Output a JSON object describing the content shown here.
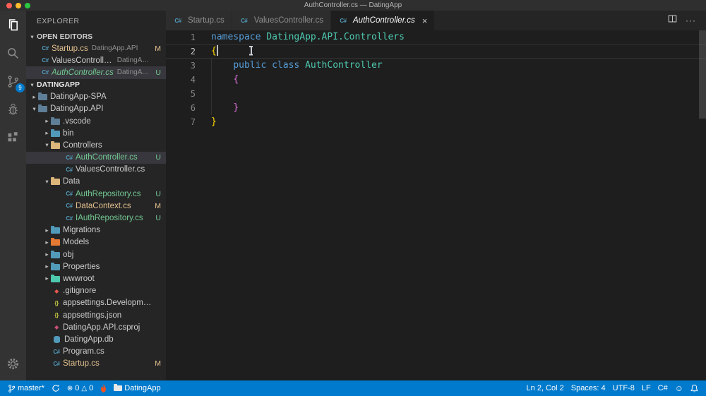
{
  "title_bar": {
    "title": "AuthController.cs — DatingApp"
  },
  "activity_bar": {
    "scm_badge": "9"
  },
  "icons": {
    "twisty_expanded": "▾",
    "twisty_collapsed": "▸",
    "close": "×",
    "error": "⊗",
    "warning": "△",
    "smiley": "☺",
    "ellipsis": "···",
    "cs_glyph": "C#",
    "json_glyph": "{}",
    "diamond_glyph": "◆"
  },
  "sidebar": {
    "title": "EXPLORER",
    "open_editors_label": "OPEN EDITORS",
    "open_editors": [
      {
        "file": "Startup.cs",
        "detail": "DatingApp.API",
        "badge": "M",
        "status": "modified",
        "active": false
      },
      {
        "file": "ValuesController.cs",
        "detail": "DatingApp...",
        "badge": "",
        "status": "none",
        "active": false
      },
      {
        "file": "AuthController.cs",
        "detail": "DatingA...",
        "badge": "U",
        "status": "untracked",
        "active": true
      }
    ],
    "project_label": "DATINGAPP",
    "tree": [
      {
        "label": "DatingApp-SPA",
        "kind": "folder",
        "depth": 0,
        "expanded": false,
        "icon_color": "#5f7e97"
      },
      {
        "label": "DatingApp.API",
        "kind": "folder",
        "depth": 0,
        "expanded": true,
        "icon_color": "#5f7e97"
      },
      {
        "label": ".vscode",
        "kind": "folder",
        "depth": 1,
        "expanded": false,
        "icon_color": "#5f7e97"
      },
      {
        "label": "bin",
        "kind": "folder",
        "depth": 1,
        "expanded": false,
        "icon_color": "#519aba"
      },
      {
        "label": "Controllers",
        "kind": "folder",
        "depth": 1,
        "expanded": true,
        "icon_color": "#dcb67a"
      },
      {
        "label": "AuthController.cs",
        "kind": "cs",
        "depth": 2,
        "badge": "U",
        "status": "untracked",
        "selected": true
      },
      {
        "label": "ValuesController.cs",
        "kind": "cs",
        "depth": 2,
        "badge": "",
        "status": "none"
      },
      {
        "label": "Data",
        "kind": "folder",
        "depth": 1,
        "expanded": true,
        "icon_color": "#dcb67a"
      },
      {
        "label": "AuthRepository.cs",
        "kind": "cs",
        "depth": 2,
        "badge": "U",
        "status": "untracked"
      },
      {
        "label": "DataContext.cs",
        "kind": "cs",
        "depth": 2,
        "badge": "M",
        "status": "modified"
      },
      {
        "label": "IAuthRepository.cs",
        "kind": "cs",
        "depth": 2,
        "badge": "U",
        "status": "untracked"
      },
      {
        "label": "Migrations",
        "kind": "folder",
        "depth": 1,
        "expanded": false,
        "icon_color": "#519aba"
      },
      {
        "label": "Models",
        "kind": "folder",
        "depth": 1,
        "expanded": false,
        "icon_color": "#e37933"
      },
      {
        "label": "obj",
        "kind": "folder",
        "depth": 1,
        "expanded": false,
        "icon_color": "#519aba"
      },
      {
        "label": "Properties",
        "kind": "folder",
        "depth": 1,
        "expanded": false,
        "icon_color": "#519aba"
      },
      {
        "label": "wwwroot",
        "kind": "folder",
        "depth": 1,
        "expanded": false,
        "icon_color": "#4ec9b0"
      },
      {
        "label": ".gitignore",
        "kind": "git",
        "depth": 1,
        "badge": "",
        "status": "none"
      },
      {
        "label": "appsettings.Development.js...",
        "kind": "json",
        "depth": 1,
        "badge": "",
        "status": "none"
      },
      {
        "label": "appsettings.json",
        "kind": "json",
        "depth": 1,
        "badge": "",
        "status": "none"
      },
      {
        "label": "DatingApp.API.csproj",
        "kind": "csproj",
        "depth": 1,
        "badge": "",
        "status": "none"
      },
      {
        "label": "DatingApp.db",
        "kind": "db",
        "depth": 1,
        "badge": "",
        "status": "none"
      },
      {
        "label": "Program.cs",
        "kind": "cs",
        "depth": 1,
        "badge": "",
        "status": "none"
      },
      {
        "label": "Startup.cs",
        "kind": "cs",
        "depth": 1,
        "badge": "M",
        "status": "modified"
      }
    ]
  },
  "editor": {
    "tabs": [
      {
        "label": "Startup.cs",
        "active": false
      },
      {
        "label": "ValuesController.cs",
        "active": false
      },
      {
        "label": "AuthController.cs",
        "active": true
      }
    ],
    "code_lines": [
      {
        "num": "1",
        "current": false,
        "tokens": [
          [
            "namespace",
            "kw"
          ],
          [
            " ",
            "pl"
          ],
          [
            "DatingApp.API.Controllers",
            "ty"
          ]
        ]
      },
      {
        "num": "2",
        "current": true,
        "tokens": [
          [
            "{",
            "b1"
          ]
        ]
      },
      {
        "num": "3",
        "current": false,
        "tokens": [
          [
            "    ",
            "pl"
          ],
          [
            "public",
            "kw"
          ],
          [
            " ",
            "pl"
          ],
          [
            "class",
            "kw"
          ],
          [
            " ",
            "pl"
          ],
          [
            "AuthController",
            "ty"
          ]
        ]
      },
      {
        "num": "4",
        "current": false,
        "tokens": [
          [
            "    ",
            "pl"
          ],
          [
            "{",
            "b2"
          ]
        ]
      },
      {
        "num": "5",
        "current": false,
        "tokens": []
      },
      {
        "num": "6",
        "current": false,
        "tokens": [
          [
            "    ",
            "pl"
          ],
          [
            "}",
            "b2"
          ]
        ]
      },
      {
        "num": "7",
        "current": false,
        "tokens": [
          [
            "}",
            "b1"
          ]
        ]
      }
    ]
  },
  "status_bar": {
    "branch": "master*",
    "errors": "0",
    "warnings": "0",
    "project": "DatingApp",
    "line_col": "Ln 2, Col 2",
    "indent": "Spaces: 4",
    "encoding": "UTF-8",
    "eol": "LF",
    "language": "C#"
  }
}
